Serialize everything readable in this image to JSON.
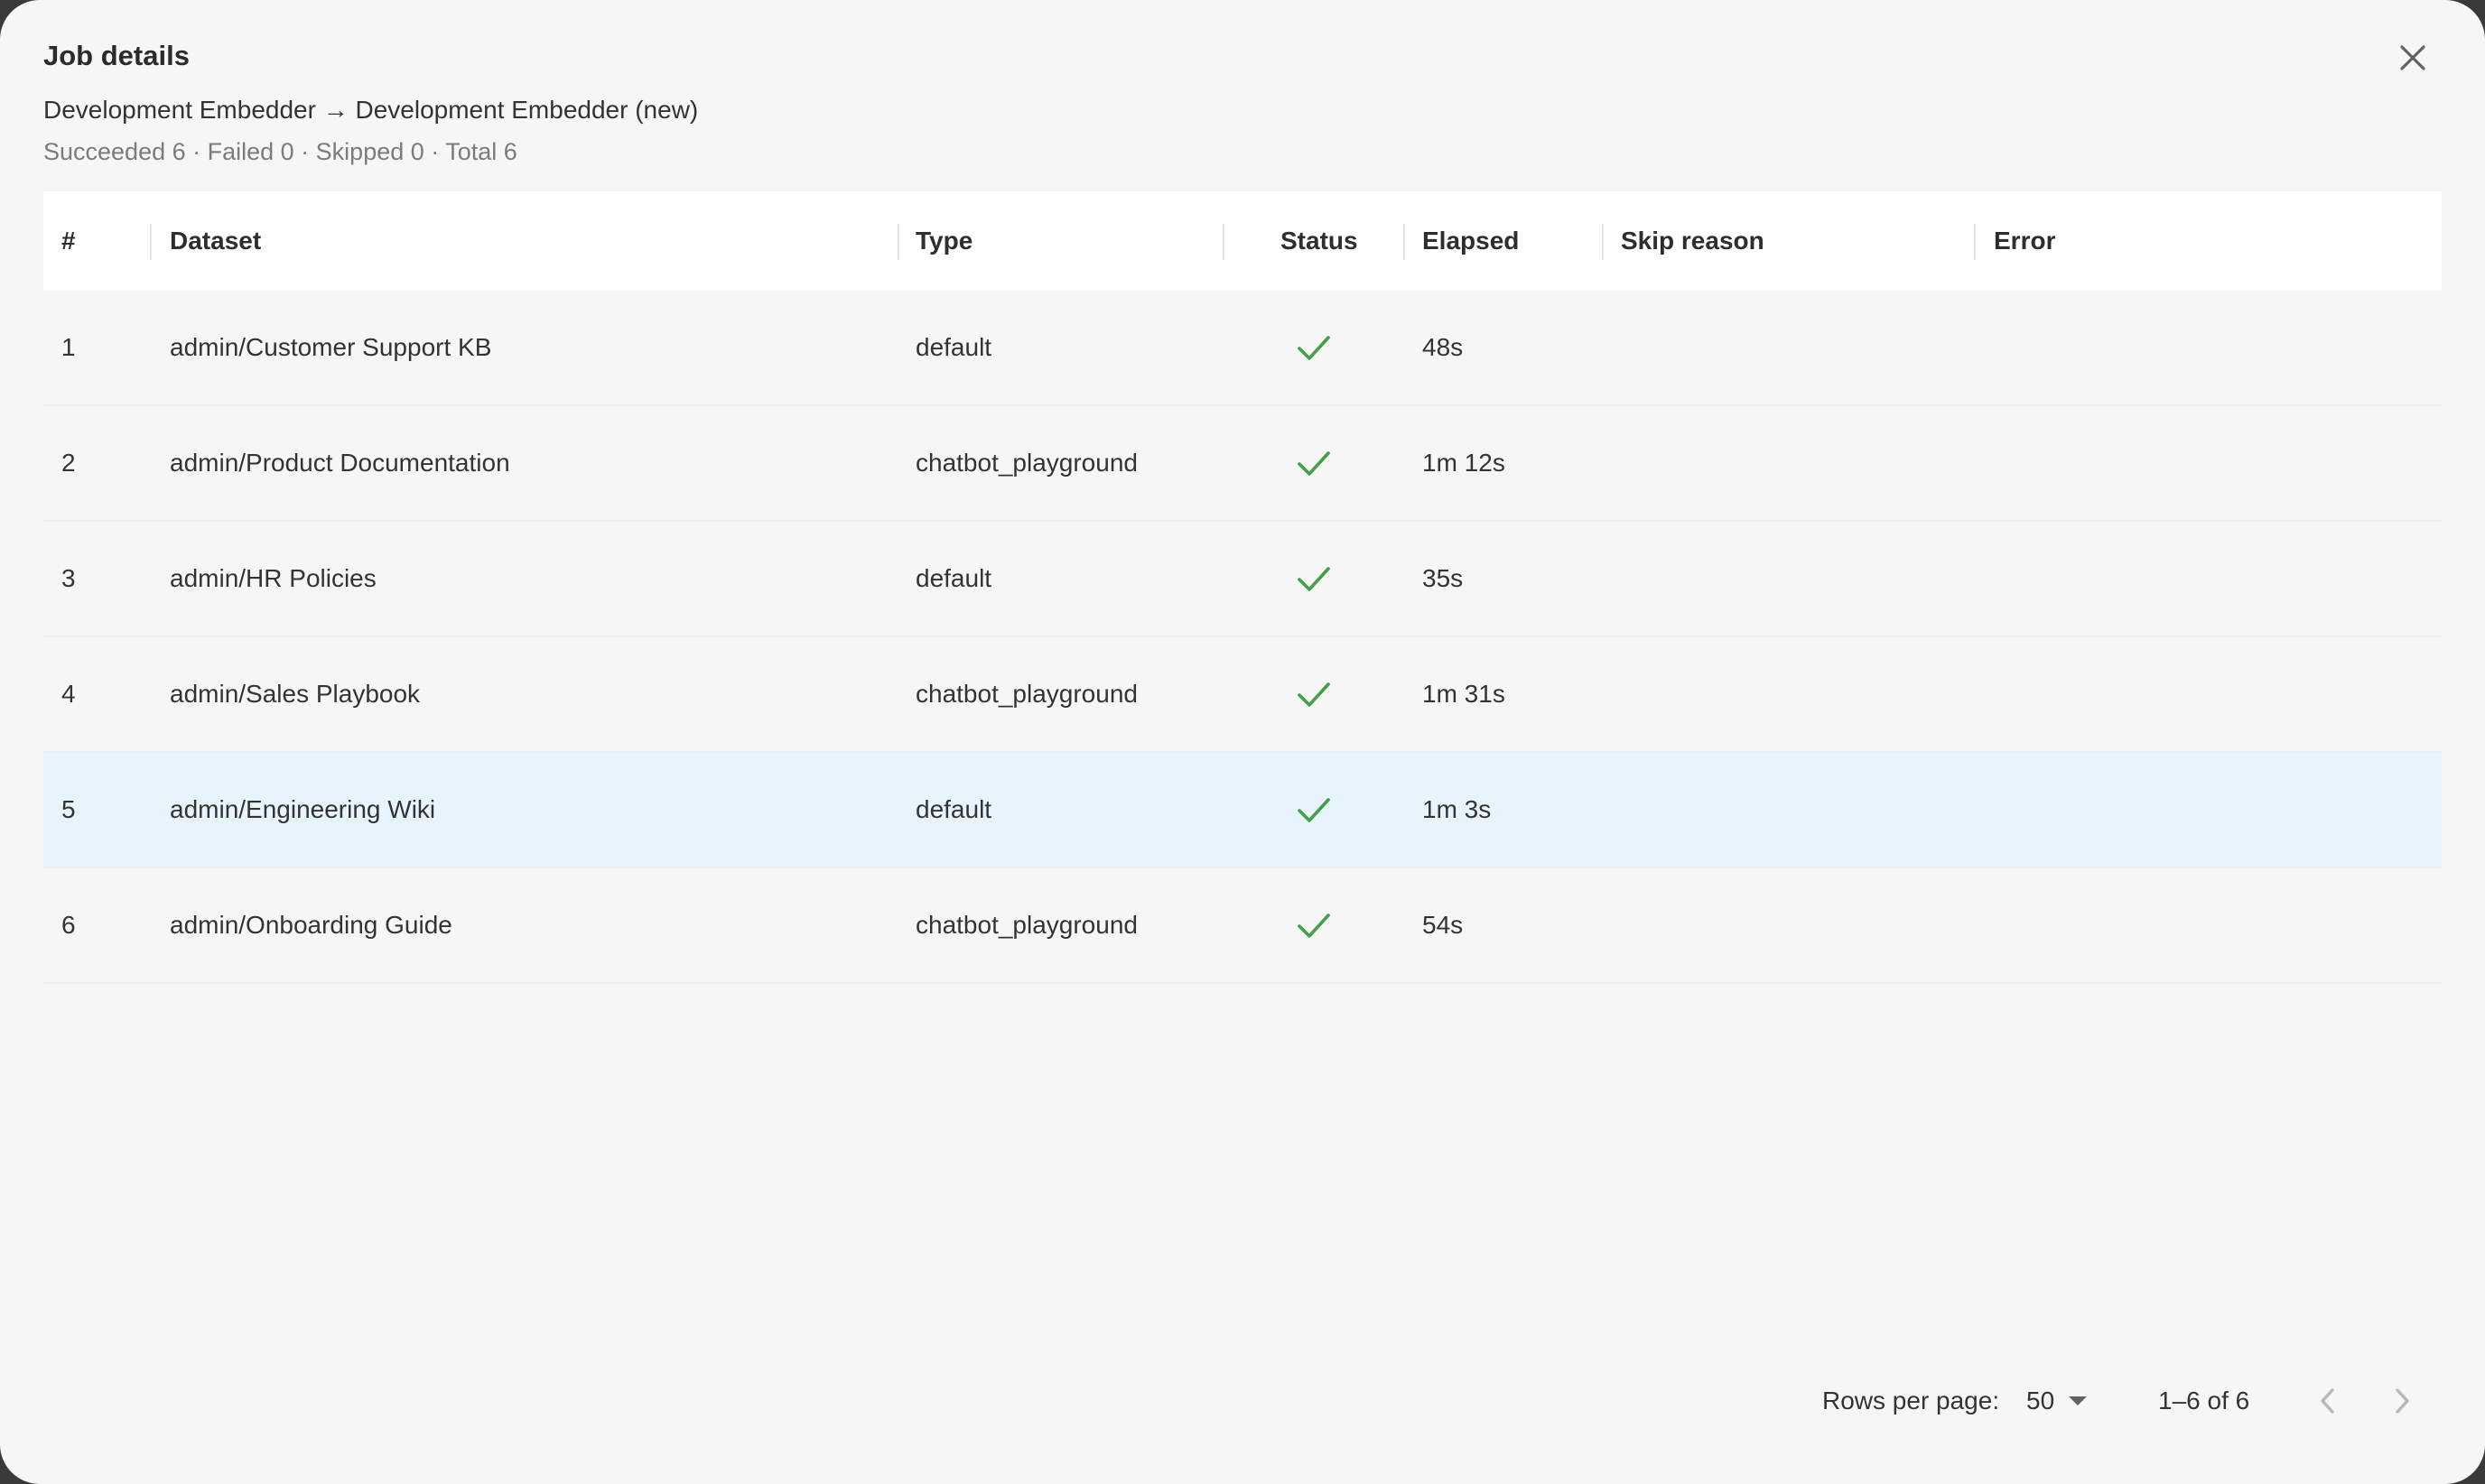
{
  "dialog": {
    "title": "Job details",
    "subtitle": "Development Embedder → Development Embedder (new)",
    "summary": "Succeeded 6 · Failed 0 · Skipped 0 · Total 6"
  },
  "table": {
    "columns": [
      "#",
      "Dataset",
      "Type",
      "Status",
      "Elapsed",
      "Skip reason",
      "Error"
    ],
    "rows": [
      {
        "index": "1",
        "dataset": "admin/Customer Support KB",
        "type": "default",
        "status": "succeeded",
        "elapsed": "48s",
        "skip_reason": "",
        "error": ""
      },
      {
        "index": "2",
        "dataset": "admin/Product Documentation",
        "type": "chatbot_playground",
        "status": "succeeded",
        "elapsed": "1m 12s",
        "skip_reason": "",
        "error": ""
      },
      {
        "index": "3",
        "dataset": "admin/HR Policies",
        "type": "default",
        "status": "succeeded",
        "elapsed": "35s",
        "skip_reason": "",
        "error": ""
      },
      {
        "index": "4",
        "dataset": "admin/Sales Playbook",
        "type": "chatbot_playground",
        "status": "succeeded",
        "elapsed": "1m 31s",
        "skip_reason": "",
        "error": ""
      },
      {
        "index": "5",
        "dataset": "admin/Engineering Wiki",
        "type": "default",
        "status": "succeeded",
        "elapsed": "1m 3s",
        "skip_reason": "",
        "error": ""
      },
      {
        "index": "6",
        "dataset": "admin/Onboarding Guide",
        "type": "chatbot_playground",
        "status": "succeeded",
        "elapsed": "54s",
        "skip_reason": "",
        "error": ""
      }
    ],
    "highlighted_row": "5"
  },
  "pagination": {
    "rows_per_page_label": "Rows per page:",
    "rows_per_page_value": "50",
    "range": "1–6 of 6"
  },
  "colors": {
    "success": "#43a047",
    "highlight": "#e8f4fd",
    "icon": "#5f6368",
    "icon_disabled": "#b8b8b8"
  },
  "icons": {
    "close": "close-icon",
    "status_success": "check-icon",
    "dropdown": "arrow-drop-down-icon",
    "prev": "chevron-left-icon",
    "next": "chevron-right-icon"
  }
}
